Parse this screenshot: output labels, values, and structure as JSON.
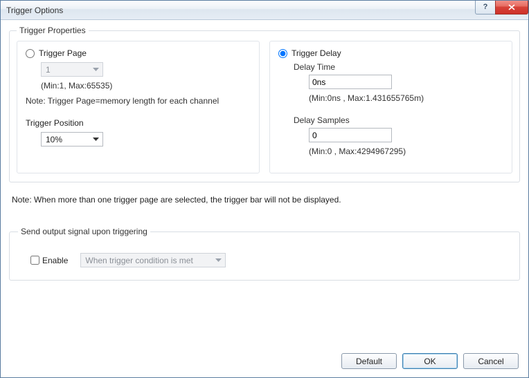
{
  "window": {
    "title": "Trigger Options"
  },
  "props": {
    "legend": "Trigger Properties",
    "triggerPage": {
      "radio": "Trigger Page",
      "value": "1",
      "hint": "(Min:1, Max:65535)",
      "note": "Note: Trigger Page=memory length for each channel"
    },
    "triggerPosition": {
      "label": "Trigger Position",
      "value": "10%"
    },
    "triggerDelay": {
      "radio": "Trigger Delay",
      "delayTime": {
        "label": "Delay Time",
        "value": "0ns",
        "hint": "(Min:0ns , Max:1.431655765m)"
      },
      "delaySamples": {
        "label": "Delay Samples",
        "value": "0",
        "hint": "(Min:0 , Max:4294967295)"
      }
    }
  },
  "note": "Note: When more than one trigger page are selected, the trigger bar will not be displayed.",
  "signal": {
    "legend": "Send output signal upon triggering",
    "enable": "Enable",
    "condition": "When trigger condition is met"
  },
  "buttons": {
    "default": "Default",
    "ok": "OK",
    "cancel": "Cancel"
  }
}
